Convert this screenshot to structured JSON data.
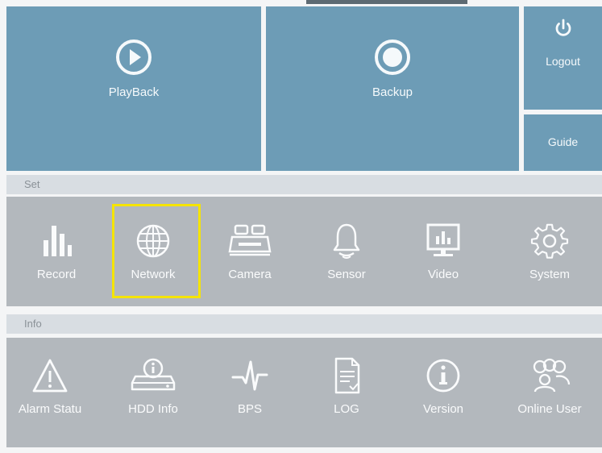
{
  "top_tiles": {
    "playback": {
      "label": "PlayBack",
      "icon": "play-circle-icon"
    },
    "backup": {
      "label": "Backup",
      "icon": "record-circle-icon"
    },
    "logout": {
      "label": "Logout",
      "icon": "power-icon"
    },
    "guide": {
      "label": "Guide"
    }
  },
  "set_section": {
    "title": "Set",
    "items": [
      {
        "label": "Record",
        "icon": "bar-chart-icon"
      },
      {
        "label": "Network",
        "icon": "globe-icon",
        "highlighted": true
      },
      {
        "label": "Camera",
        "icon": "camera-icon"
      },
      {
        "label": "Sensor",
        "icon": "bell-icon"
      },
      {
        "label": "Video",
        "icon": "monitor-icon"
      },
      {
        "label": "System",
        "icon": "gear-icon"
      }
    ]
  },
  "info_section": {
    "title": "Info",
    "items": [
      {
        "label": "Alarm Statu",
        "icon": "warning-icon"
      },
      {
        "label": "HDD Info",
        "icon": "hdd-info-icon"
      },
      {
        "label": "BPS",
        "icon": "pulse-icon"
      },
      {
        "label": "LOG",
        "icon": "log-document-icon"
      },
      {
        "label": "Version",
        "icon": "info-icon"
      },
      {
        "label": "Online User",
        "icon": "users-icon"
      }
    ]
  },
  "colors": {
    "tile_blue": "#6d9cb6",
    "panel_gray": "#b3b8bd",
    "header_gray": "#d8dde2",
    "highlight_yellow": "#f5e400"
  }
}
